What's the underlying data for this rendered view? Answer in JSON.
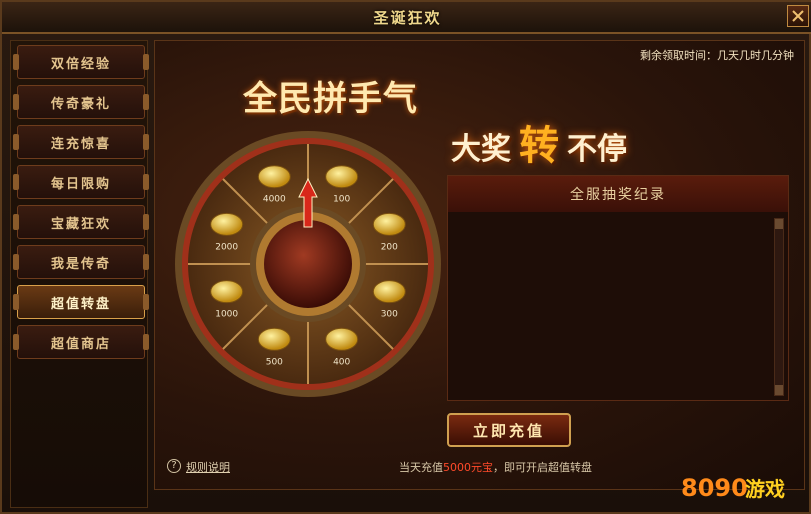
{
  "window": {
    "title": "圣诞狂欢"
  },
  "sidebar": {
    "items": [
      {
        "label": "双倍经验"
      },
      {
        "label": "传奇豪礼"
      },
      {
        "label": "连充惊喜"
      },
      {
        "label": "每日限购"
      },
      {
        "label": "宝藏狂欢"
      },
      {
        "label": "我是传奇"
      },
      {
        "label": "超值转盘",
        "active": true
      },
      {
        "label": "超值商店"
      }
    ]
  },
  "main": {
    "timer": "剩余领取时间：几天几时几分钟",
    "headline1": "全民拼手气",
    "headline2_a": "大奖",
    "headline2_b": "转",
    "headline2_c": "不停",
    "records_title": "全服抽奖纪录",
    "recharge_button": "立即充值",
    "help_icon": "?",
    "rules_link": "规则说明",
    "notice_pre": "当天充值",
    "notice_amount": "5000元宝",
    "notice_post": "，即可开启超值转盘"
  },
  "wheel": {
    "prizes": [
      {
        "amount": "100",
        "icon": "gold-ingot-icon"
      },
      {
        "amount": "200",
        "icon": "gold-ingots-icon"
      },
      {
        "amount": "300",
        "icon": "gold-ingots-icon"
      },
      {
        "amount": "400",
        "icon": "gold-ingots-icon"
      },
      {
        "amount": "500",
        "icon": "treasure-bag-icon"
      },
      {
        "amount": "1000",
        "icon": "gold-pile-icon"
      },
      {
        "amount": "2000",
        "icon": "gold-pile-icon"
      },
      {
        "amount": "4000",
        "icon": "gold-chest-icon"
      }
    ]
  },
  "logo": {
    "text_a": "8090",
    "text_b": "游戏"
  },
  "colors": {
    "accent": "#f0d88c",
    "highlight": "#ff4a2a",
    "wheel_rim": "#a0301a"
  }
}
